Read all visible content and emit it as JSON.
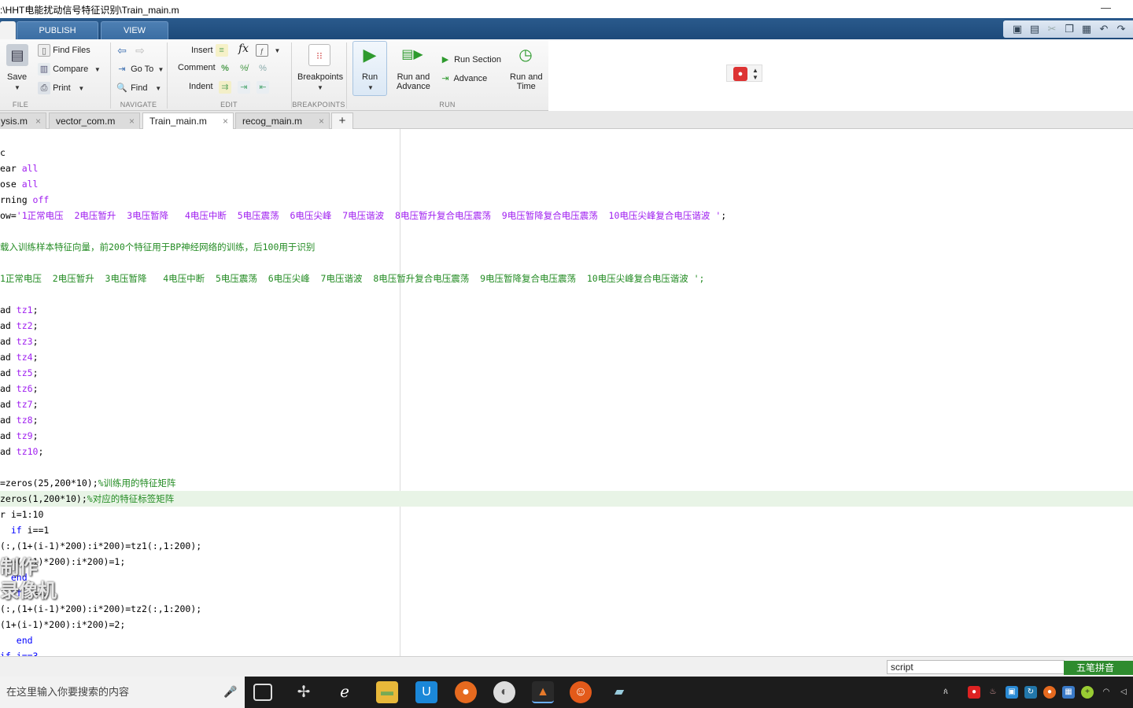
{
  "window": {
    "title": ":\\HHT电能扰动信号特征识别\\Train_main.m",
    "minimize": "—"
  },
  "ribbon_tabs": [
    {
      "label": "PUBLISH"
    },
    {
      "label": "VIEW"
    }
  ],
  "ribbon": {
    "file": {
      "save": "Save",
      "section": "FILE"
    },
    "find_files": "Find Files",
    "compare": "Compare",
    "print": "Print",
    "navigate": {
      "goto": "Go To",
      "find": "Find",
      "section": "NAVIGATE"
    },
    "edit": {
      "insert": "Insert",
      "comment": "Comment",
      "indent": "Indent",
      "fx": "fx",
      "section": "EDIT"
    },
    "breakpoints": {
      "label": "Breakpoints",
      "section": "BREAKPOINTS"
    },
    "run": {
      "run": "Run",
      "run_advance_1": "Run and",
      "run_advance_2": "Advance",
      "run_section": "Run Section",
      "advance": "Advance",
      "run_time_1": "Run and",
      "run_time_2": "Time",
      "section": "RUN"
    }
  },
  "file_tabs": [
    {
      "label": "ysis.m"
    },
    {
      "label": "vector_com.m"
    },
    {
      "label": "Train_main.m"
    },
    {
      "label": "recog_main.m"
    }
  ],
  "add_tab": "+",
  "code_lines": [
    {
      "parts": [
        {
          "t": "c",
          "c": ""
        }
      ]
    },
    {
      "parts": [
        {
          "t": "ear ",
          "c": ""
        },
        {
          "t": "all",
          "c": "str"
        }
      ]
    },
    {
      "parts": [
        {
          "t": "ose ",
          "c": ""
        },
        {
          "t": "all",
          "c": "str"
        }
      ]
    },
    {
      "parts": [
        {
          "t": "rning ",
          "c": ""
        },
        {
          "t": "off",
          "c": "str"
        }
      ]
    },
    {
      "parts": [
        {
          "t": "ow=",
          "c": ""
        },
        {
          "t": "'1正常电压  2电压暂升  3电压暂降   4电压中断  5电压震荡  6电压尖峰  7电压谐波  8电压暂升复合电压震荡  9电压暂降复合电压震荡  10电压尖峰复合电压谐波 '",
          "c": "str"
        },
        {
          "t": ";",
          "c": ""
        }
      ]
    },
    {
      "parts": [
        {
          "t": "",
          "c": ""
        }
      ]
    },
    {
      "parts": [
        {
          "t": "载入训练样本特征向量，前200个特征用于BP神经网络的训练，后100用于识别",
          "c": "com"
        }
      ]
    },
    {
      "parts": [
        {
          "t": "",
          "c": ""
        }
      ]
    },
    {
      "parts": [
        {
          "t": "1正常电压  2电压暂升  3电压暂降   4电压中断  5电压震荡  6电压尖峰  7电压谐波  8电压暂升复合电压震荡  9电压暂降复合电压震荡  10电压尖峰复合电压谐波 ';",
          "c": "com"
        }
      ]
    },
    {
      "parts": [
        {
          "t": "",
          "c": ""
        }
      ]
    },
    {
      "parts": [
        {
          "t": "ad ",
          "c": ""
        },
        {
          "t": "tz1",
          "c": "str"
        },
        {
          "t": ";",
          "c": ""
        }
      ]
    },
    {
      "parts": [
        {
          "t": "ad ",
          "c": ""
        },
        {
          "t": "tz2",
          "c": "str"
        },
        {
          "t": ";",
          "c": ""
        }
      ]
    },
    {
      "parts": [
        {
          "t": "ad ",
          "c": ""
        },
        {
          "t": "tz3",
          "c": "str"
        },
        {
          "t": ";",
          "c": ""
        }
      ]
    },
    {
      "parts": [
        {
          "t": "ad ",
          "c": ""
        },
        {
          "t": "tz4",
          "c": "str"
        },
        {
          "t": ";",
          "c": ""
        }
      ]
    },
    {
      "parts": [
        {
          "t": "ad ",
          "c": ""
        },
        {
          "t": "tz5",
          "c": "str"
        },
        {
          "t": ";",
          "c": ""
        }
      ]
    },
    {
      "parts": [
        {
          "t": "ad ",
          "c": ""
        },
        {
          "t": "tz6",
          "c": "str"
        },
        {
          "t": ";",
          "c": ""
        }
      ]
    },
    {
      "parts": [
        {
          "t": "ad ",
          "c": ""
        },
        {
          "t": "tz7",
          "c": "str"
        },
        {
          "t": ";",
          "c": ""
        }
      ]
    },
    {
      "parts": [
        {
          "t": "ad ",
          "c": ""
        },
        {
          "t": "tz8",
          "c": "str"
        },
        {
          "t": ";",
          "c": ""
        }
      ]
    },
    {
      "parts": [
        {
          "t": "ad ",
          "c": ""
        },
        {
          "t": "tz9",
          "c": "str"
        },
        {
          "t": ";",
          "c": ""
        }
      ]
    },
    {
      "parts": [
        {
          "t": "ad ",
          "c": ""
        },
        {
          "t": "tz10",
          "c": "str"
        },
        {
          "t": ";",
          "c": ""
        }
      ]
    },
    {
      "parts": [
        {
          "t": "",
          "c": ""
        }
      ]
    },
    {
      "parts": [
        {
          "t": "=zeros(25,200*10);",
          "c": ""
        },
        {
          "t": "%训练用的特征矩阵",
          "c": "com"
        }
      ]
    },
    {
      "parts": [
        {
          "t": "zeros(1,200*10);",
          "c": ""
        },
        {
          "t": "%对应的特征标签矩阵",
          "c": "com"
        }
      ],
      "highlight": true
    },
    {
      "parts": [
        {
          "t": "r i=1:10",
          "c": ""
        }
      ]
    },
    {
      "parts": [
        {
          "t": "  ",
          "c": ""
        },
        {
          "t": "if",
          "c": "kw"
        },
        {
          "t": " i==1",
          "c": ""
        }
      ]
    },
    {
      "parts": [
        {
          "t": "(:,(1+(i-1)*200):i*200)=tz1(:,1:200);",
          "c": ""
        }
      ]
    },
    {
      "parts": [
        {
          "t": "(1+(i-1)*200):i*200)=1;",
          "c": ""
        }
      ]
    },
    {
      "parts": [
        {
          "t": "  ",
          "c": ""
        },
        {
          "t": "end",
          "c": "kw"
        }
      ]
    },
    {
      "parts": [
        {
          "t": "  ",
          "c": ""
        },
        {
          "t": "if",
          "c": "kw"
        },
        {
          "t": " i==2",
          "c": ""
        }
      ]
    },
    {
      "parts": [
        {
          "t": "(:,(1+(i-1)*200):i*200)=tz2(:,1:200);",
          "c": ""
        }
      ]
    },
    {
      "parts": [
        {
          "t": "(1+(i-1)*200):i*200)=2;",
          "c": ""
        }
      ]
    },
    {
      "parts": [
        {
          "t": "   ",
          "c": ""
        },
        {
          "t": "end",
          "c": "kw"
        }
      ]
    },
    {
      "parts": [
        {
          "t": "if i==3",
          "c": "kw"
        }
      ]
    }
  ],
  "watermark": {
    "line1": "制作",
    "line2": "录像机"
  },
  "status": {
    "mode": "script",
    "ime": "五笔拼音"
  },
  "taskbar": {
    "search_placeholder": "在这里输入你要搜索的内容"
  },
  "colors": {
    "keyword": "#0000ff",
    "string": "#a020f0",
    "comment": "#228b22",
    "ribbon_tab_bar": "#1d4a7a"
  }
}
